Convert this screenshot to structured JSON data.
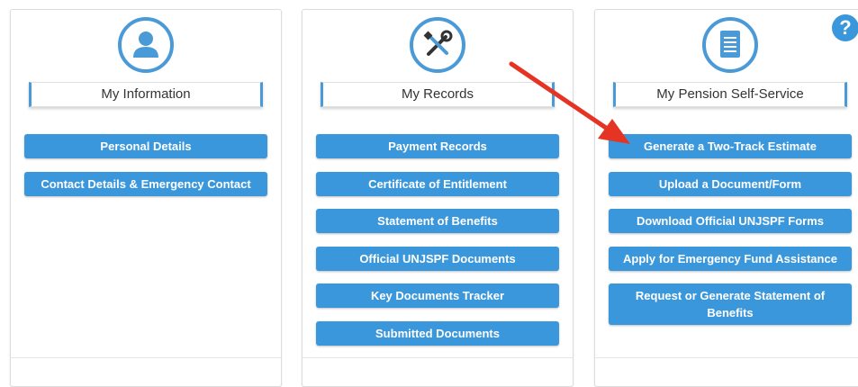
{
  "cards": [
    {
      "title": "My Information",
      "icon": "person-icon",
      "buttons": [
        "Personal Details",
        "Contact Details & Emergency Contact"
      ]
    },
    {
      "title": "My Records",
      "icon": "tools-icon",
      "buttons": [
        "Payment Records",
        "Certificate of Entitlement",
        "Statement of Benefits",
        "Official UNJSPF Documents",
        "Key Documents Tracker",
        "Submitted Documents"
      ]
    },
    {
      "title": "My Pension Self-Service",
      "icon": "document-icon",
      "buttons": [
        "Generate a Two-Track Estimate",
        "Upload a Document/Form",
        "Download Official UNJSPF Forms",
        "Apply for Emergency Fund Assistance",
        "Request or Generate Statement of Benefits"
      ]
    }
  ],
  "help": {
    "label": "?",
    "icon": "help-icon"
  },
  "colors": {
    "accent": "#3b97db",
    "arrow": "#e53324"
  }
}
